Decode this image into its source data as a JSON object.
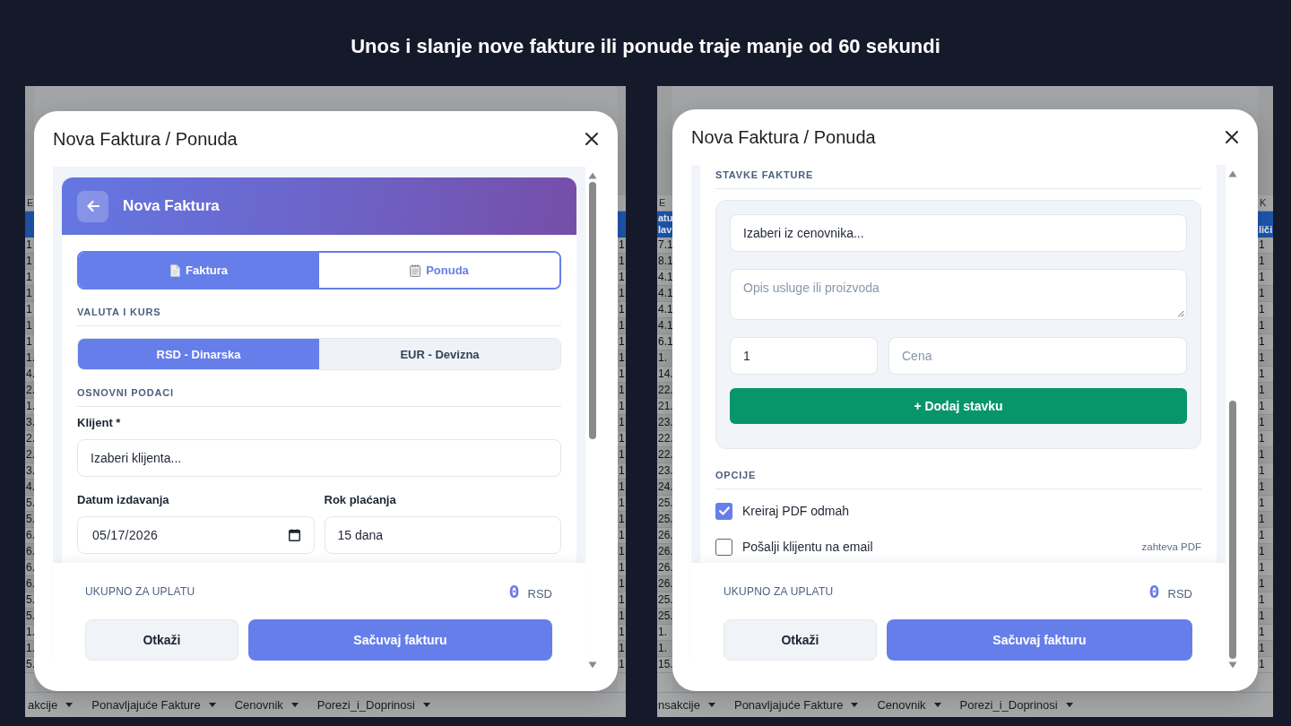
{
  "headline": "Unos i slanje nove fakture ili ponude traje manje od 60 sekundi",
  "panels": [
    {
      "sheet": {
        "left_column": {
          "letter": "E",
          "cells": [
            "1",
            "1",
            "1",
            "1",
            "1",
            "1",
            "1",
            "1.",
            "4.",
            "2.",
            "1.",
            "3.",
            "2.",
            "2.",
            "3.",
            "4.",
            "5.",
            "5.",
            "6.",
            "6.",
            "6.",
            "6.",
            "5.",
            "5.",
            "1.",
            "1.",
            "5."
          ]
        },
        "right_column": {
          "cells": [
            "1",
            "1",
            "1",
            "1",
            "1",
            "1",
            "1",
            "1",
            "1",
            "1",
            "1",
            "1",
            "1",
            "1",
            "1",
            "1",
            "1",
            "1",
            "1",
            "1",
            "1",
            "1",
            "1",
            "1",
            "1",
            "1",
            "1"
          ]
        },
        "tabs": [
          "akcije",
          "Ponavljajuće Fakture",
          "Cenovnik",
          "Porezi_i_Doprinosi"
        ]
      },
      "dialog": {
        "title": "Nova Faktura / Ponuda",
        "body": [
          {
            "kind": "card_header",
            "title": "Nova Faktura"
          },
          {
            "kind": "doc_type_toggle",
            "options": [
              {
                "label": "Faktura",
                "selected": true
              },
              {
                "label": "Ponuda",
                "selected": false
              }
            ]
          },
          {
            "kind": "section",
            "title": "VALUTA I KURS"
          },
          {
            "kind": "currency_toggle",
            "options": [
              {
                "label": "RSD - Dinarska",
                "selected": true
              },
              {
                "label": "EUR - Devizna",
                "selected": false
              }
            ]
          },
          {
            "kind": "section",
            "title": "OSNOVNI PODACI"
          },
          {
            "kind": "field",
            "label": "Klijent *",
            "field": {
              "kind": "select",
              "value": "Izaberi klijenta..."
            }
          },
          {
            "kind": "field_row",
            "fields": [
              {
                "label": "Datum izdavanja",
                "field": {
                  "kind": "date",
                  "value": "05/17/2026"
                }
              },
              {
                "label": "Rok plaćanja",
                "field": {
                  "kind": "select",
                  "value": "15 dana"
                }
              }
            ]
          }
        ],
        "total": {
          "label": "UKUPNO ZA UPLATU",
          "amount": "0",
          "currency": "RSD"
        },
        "actions": [
          {
            "label": "Otkaži",
            "kind": "secondary"
          },
          {
            "label": "Sačuvaj fakturu",
            "kind": "primary"
          }
        ]
      }
    },
    {
      "sheet": {
        "left_column": {
          "letter": "E",
          "header": [
            "atu",
            "lav"
          ],
          "cells": [
            "7.1",
            "8.1",
            "4.1",
            "4.1",
            "4.1",
            "4.1",
            "6.1",
            "1.",
            "14.",
            "22.",
            "21.",
            "23.",
            "22.",
            "22.",
            "23.",
            "24.",
            "25.",
            "25.",
            "26.",
            "26.",
            "26.",
            "26.",
            "25.",
            "25.",
            "1.",
            "1.",
            "15."
          ]
        },
        "right_column": {
          "letter": "K",
          "header": [
            "liči"
          ],
          "cells": [
            "1",
            "1",
            "1",
            "1",
            "1",
            "1",
            "1",
            "1",
            "1",
            "1",
            "1",
            "1",
            "1",
            "1",
            "1",
            "1",
            "1",
            "1",
            "1",
            "1",
            "1",
            "1",
            "1",
            "1",
            "1",
            "1",
            "1"
          ]
        },
        "tabs": [
          "nsakcije",
          "Ponavljajuće Fakture",
          "Cenovnik",
          "Porezi_i_Doprinosi"
        ]
      },
      "dialog": {
        "title": "Nova Faktura / Ponuda",
        "body": [
          {
            "kind": "section",
            "title": "STAVKE FAKTURE"
          },
          {
            "kind": "item_box",
            "rows": [
              [
                {
                  "kind": "select",
                  "value": "Izaberi iz cenovnika..."
                }
              ],
              [
                {
                  "kind": "textarea",
                  "placeholder": "Opis usluge ili proizvoda"
                }
              ],
              [
                {
                  "kind": "number",
                  "value": "1"
                },
                {
                  "kind": "text",
                  "placeholder": "Cena"
                }
              ]
            ],
            "button": "+ Dodaj stavku"
          },
          {
            "kind": "section",
            "title": "OPCIJE"
          },
          {
            "kind": "checkbox",
            "label": "Kreiraj PDF odmah",
            "checked": true
          },
          {
            "kind": "checkbox",
            "label": "Pošalji klijentu na email",
            "checked": false,
            "note": "zahteva PDF"
          }
        ],
        "total": {
          "label": "UKUPNO ZA UPLATU",
          "amount": "0",
          "currency": "RSD"
        },
        "actions": [
          {
            "label": "Otkaži",
            "kind": "secondary"
          },
          {
            "label": "Sačuvaj fakturu",
            "kind": "primary"
          }
        ]
      }
    }
  ]
}
